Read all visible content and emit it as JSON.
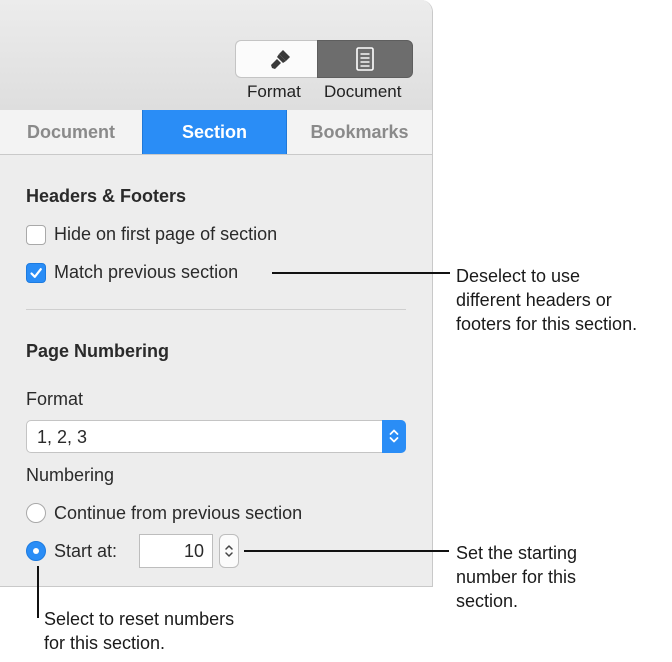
{
  "toolbar": {
    "format_label": "Format",
    "document_label": "Document",
    "format_icon": "paintbrush-icon",
    "document_icon": "document-icon"
  },
  "tabs": [
    {
      "label": "Document",
      "active": false
    },
    {
      "label": "Section",
      "active": true
    },
    {
      "label": "Bookmarks",
      "active": false
    }
  ],
  "headers_footers": {
    "heading": "Headers & Footers",
    "hide_first_page": {
      "label": "Hide on first page of section",
      "checked": false
    },
    "match_previous": {
      "label": "Match previous section",
      "checked": true
    }
  },
  "page_numbering": {
    "heading": "Page Numbering",
    "format_label": "Format",
    "format_value": "1, 2, 3",
    "numbering_label": "Numbering",
    "continue_option": {
      "label": "Continue from previous section",
      "selected": false
    },
    "start_option": {
      "label": "Start at:",
      "selected": true
    },
    "start_value": "10"
  },
  "callouts": {
    "match_previous": [
      "Deselect to use",
      "different headers or",
      "footers for this section."
    ],
    "start_value": [
      "Set the starting",
      "number for this",
      "section."
    ],
    "start_option": [
      "Select to reset numbers",
      "for this section."
    ]
  },
  "colors": {
    "accent": "#2a8df6",
    "panel_background": "#ededed",
    "active_segment": "#6d6d6d"
  }
}
